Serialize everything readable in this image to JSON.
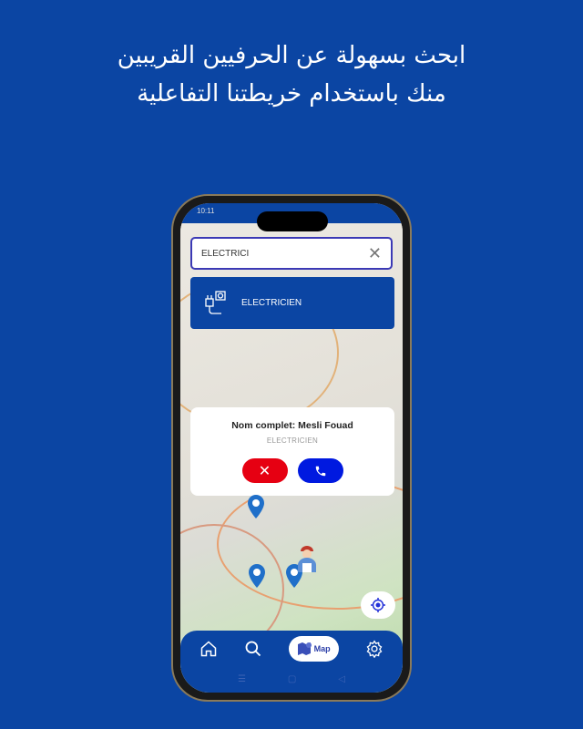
{
  "headline": {
    "line1": "ابحث بسهولة عن الحرفيين القريبين",
    "line2": "منك باستخدام خريطتنا التفاعلية"
  },
  "status": {
    "time": "10:11"
  },
  "search": {
    "value": "ELECTRICI",
    "clear_icon": "close-icon"
  },
  "suggestion": {
    "label": "ELECTRICIEN",
    "icon": "electric-plug-icon"
  },
  "card": {
    "name": "Nom complet: Mesli Fouad",
    "job": "ELECTRICIEN"
  },
  "nav": {
    "map_label": "Map"
  },
  "colors": {
    "brand": "#0b45a3",
    "cancel": "#e60012",
    "call": "#0019e0"
  }
}
